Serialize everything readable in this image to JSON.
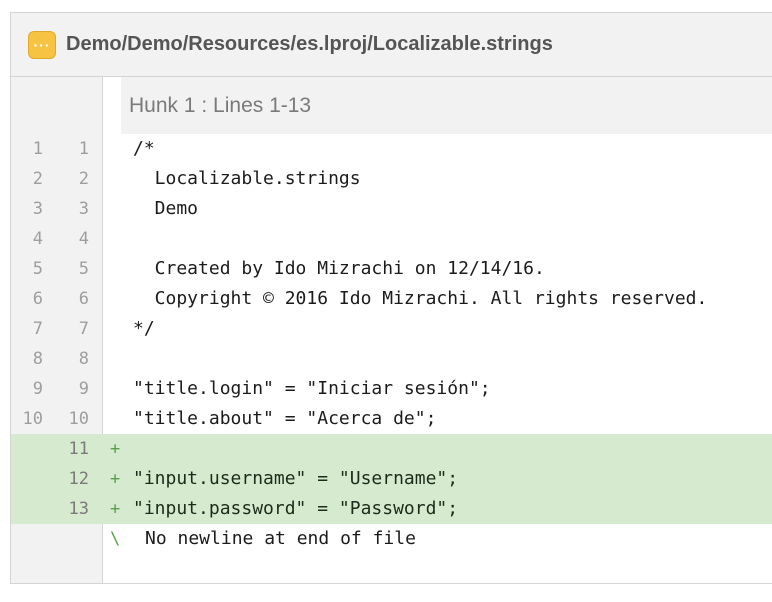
{
  "file": {
    "icon": "strings-file-icon",
    "icon_glyph": "···",
    "path": "Demo/Demo/Resources/es.lproj/Localizable.strings"
  },
  "hunk": {
    "label": "Hunk 1 : Lines 1-13"
  },
  "lines": [
    {
      "old": "1",
      "new": "1",
      "marker": "",
      "text": "/*",
      "type": "context"
    },
    {
      "old": "2",
      "new": "2",
      "marker": "",
      "text": "  Localizable.strings",
      "type": "context"
    },
    {
      "old": "3",
      "new": "3",
      "marker": "",
      "text": "  Demo",
      "type": "context"
    },
    {
      "old": "4",
      "new": "4",
      "marker": "",
      "text": "",
      "type": "context"
    },
    {
      "old": "5",
      "new": "5",
      "marker": "",
      "text": "  Created by Ido Mizrachi on 12/14/16.",
      "type": "context"
    },
    {
      "old": "6",
      "new": "6",
      "marker": "",
      "text": "  Copyright © 2016 Ido Mizrachi. All rights reserved.",
      "type": "context"
    },
    {
      "old": "7",
      "new": "7",
      "marker": "",
      "text": "*/",
      "type": "context"
    },
    {
      "old": "8",
      "new": "8",
      "marker": "",
      "text": "",
      "type": "context"
    },
    {
      "old": "9",
      "new": "9",
      "marker": "",
      "text": "\"title.login\" = \"Iniciar sesión\";",
      "type": "context"
    },
    {
      "old": "10",
      "new": "10",
      "marker": "",
      "text": "\"title.about\" = \"Acerca de\";",
      "type": "context"
    },
    {
      "old": "",
      "new": "11",
      "marker": "+",
      "text": "",
      "type": "added"
    },
    {
      "old": "",
      "new": "12",
      "marker": "+",
      "text": "\"input.username\" = \"Username\";",
      "type": "added"
    },
    {
      "old": "",
      "new": "13",
      "marker": "+",
      "text": "\"input.password\" = \"Password\";",
      "type": "added"
    }
  ],
  "eof": {
    "marker": "\\",
    "text": "No newline at end of file"
  },
  "colors": {
    "added_background": "#d6ead0",
    "added_marker": "#5aa04a",
    "gutter_background": "#f2f2f2",
    "icon_background": "#f6c343"
  }
}
